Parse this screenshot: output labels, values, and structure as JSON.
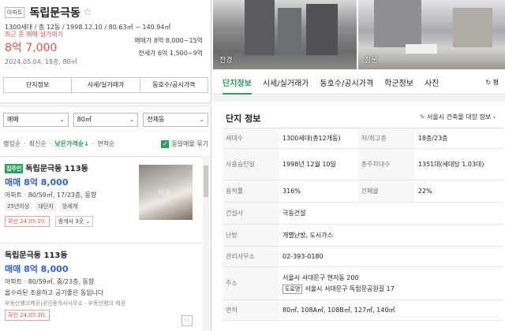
{
  "header": {
    "type_tag": "아파트",
    "name": "독립문극동",
    "favorite_icon": "star-outline-icon",
    "summary": "1300세대 / 총 12동 / 1998.12.10 / 80.63㎡ ~ 140.94㎡"
  },
  "recent_trade": {
    "label": "최근 준 매매 실거래가",
    "price": "8억 7,000",
    "meta": "2024.05.04, 18층, 80㎡",
    "sale_range": "매매가 8억 8,000~15억",
    "jeonse_range": "전세가 6억 1,500~9억"
  },
  "left_tabs": [
    "단지정보",
    "시세/실거래가",
    "동호수/공시가격"
  ],
  "filters": {
    "trade_type": "매매",
    "area": "80㎡",
    "building": "전체동"
  },
  "sorts": [
    "랭킹순",
    "최신순",
    "낮은가격순↓",
    "면적순"
  ],
  "same_listing_label": "동일매물 묶기",
  "listings": [
    {
      "badge": "집주인",
      "title": "독립문극동 113동",
      "price": "매매 8억 8,000",
      "detail": "아파트 · 80/59㎡, 17/23층, 동향",
      "chips": [
        "25년이상",
        "대단지",
        "방세개"
      ],
      "confirmed": "확인 24.05.20.",
      "brokers": "중개사 3곳",
      "thumb_watermark": "아실"
    },
    {
      "title": "독립문극동 113동",
      "price": "매매 8억 8,000",
      "detail": "아파트 · 80/59㎡, 중/23층, 동향",
      "desc": "올수리된 조용하고 공기좋은 동입니다",
      "agents": "부동산뱅크제공|공인중개사사무소  ·  부동산뱅크 제공",
      "confirmed": "확인 24.05.20."
    }
  ],
  "photos": [
    {
      "label": "전경"
    },
    {
      "label": "정문"
    }
  ],
  "right_tabs": [
    "단지정보",
    "시세/실거래가",
    "동호수/공시가격",
    "학군정보",
    "사진"
  ],
  "refresh_label": "↻ 평",
  "section": {
    "title": "단지 정보",
    "link": "서울시 건축물 대장 정보 ›"
  },
  "info": {
    "households_k": "세대수",
    "households_v": "1300세대(총12개동)",
    "floors_k": "저/최고층",
    "floors_v": "18층/23층",
    "approval_k": "사용승인일",
    "approval_v": "1998년 12월 10일",
    "parking_k": "총주차대수",
    "parking_v": "1351대(세대당 1.03대)",
    "far_k": "용적률",
    "far_v": "316%",
    "bcr_k": "건폐율",
    "bcr_v": "22%",
    "builder_k": "건설사",
    "builder_v": "극동건설",
    "heating_k": "난방",
    "heating_v": "개별난방, 도시가스",
    "office_k": "관리사무소",
    "office_v": "02-393-0180",
    "addr_k": "주소",
    "addr_v": "서울시 서대문구 현저동 200",
    "road_tag": "도로명",
    "road_v": "서울시 서대문구 독립문공원길 17",
    "area_k": "면적",
    "area_v": "80㎡, 108A㎡, 108B㎡, 127㎡, 140㎡"
  }
}
